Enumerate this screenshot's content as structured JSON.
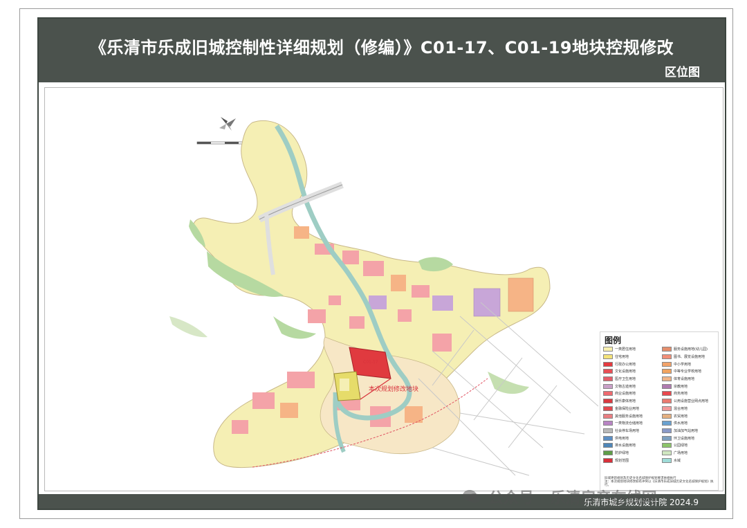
{
  "header": {
    "title": "《乐清市乐成旧城控制性详细规划（修编）》C01-17、C01-19地块控规修改",
    "subtitle": "区位图"
  },
  "map": {
    "site_label": "本次规划修改地块",
    "site_parcel_code": "C01-17",
    "north_arrow": "north-arrow",
    "scale_bar": "scale-bar",
    "colors": {
      "residential": "#f5efb4",
      "commercial": "#f4a3a8",
      "site": "#e03a3f",
      "river": "#9ecdc4",
      "greenland": "#b6d9a1",
      "admin": "#c8a6d8",
      "orange": "#f6b486",
      "road": "#ffffff"
    }
  },
  "legend": {
    "title": "图例",
    "items": [
      {
        "label": "一类居住用地",
        "color": "#f8f0b0"
      },
      {
        "label": "服务设施用地(幼儿园)",
        "color": "#e58e6c"
      },
      {
        "label": "住宅用地",
        "color": "#f4e37a"
      },
      {
        "label": "图书、展览设施用地",
        "color": "#f28f78"
      },
      {
        "label": "行政办公用地",
        "color": "#e53a3f"
      },
      {
        "label": "中小学用地",
        "color": "#f2a36a"
      },
      {
        "label": "文化设施用地",
        "color": "#e84e55"
      },
      {
        "label": "中等专业学校用地",
        "color": "#f1a45f"
      },
      {
        "label": "医疗卫生用地",
        "color": "#e55e6a"
      },
      {
        "label": "体育设施用地",
        "color": "#f0b488"
      },
      {
        "label": "文物古迹用地",
        "color": "#c9a0c8"
      },
      {
        "label": "宗教用地",
        "color": "#b07ab0"
      },
      {
        "label": "商业设施用地",
        "color": "#ee6a6f"
      },
      {
        "label": "商务用地",
        "color": "#e8484e"
      },
      {
        "label": "娱乐康体用地",
        "color": "#d93a40"
      },
      {
        "label": "公用设施营业网点用地",
        "color": "#ea7a70"
      },
      {
        "label": "金融保险业用地",
        "color": "#e2494f"
      },
      {
        "label": "混合用地",
        "color": "#f29a9a"
      },
      {
        "label": "其他服务设施用地",
        "color": "#e97e82"
      },
      {
        "label": "农贸用地",
        "color": "#e5b080"
      },
      {
        "label": "一类物流仓储用地",
        "color": "#b884c4"
      },
      {
        "label": "供水用地",
        "color": "#6aa2d0"
      },
      {
        "label": "社会停车场用地",
        "color": "#b9b9b9"
      },
      {
        "label": "加油加气站用地",
        "color": "#8a9ac8"
      },
      {
        "label": "供电用地",
        "color": "#5c8ec4"
      },
      {
        "label": "环卫设施用地",
        "color": "#7da0c0"
      },
      {
        "label": "排水设施用地",
        "color": "#4f86b8"
      },
      {
        "label": "公园绿地",
        "color": "#8cc46a"
      },
      {
        "label": "防护绿地",
        "color": "#5e9c48"
      },
      {
        "label": "广场用地",
        "color": "#cfe6c0"
      },
      {
        "label": "规划范围",
        "color": "#d8303a"
      },
      {
        "label": "水域",
        "color": "#9edcd8"
      }
    ],
    "notes": [
      "旧城更新规划及历史文化名城保护规划要求依规执行",
      "注：本次规划地块修改如有冲突以《乐清市乐成旧城历史文化名城保护规划》执行。"
    ]
  },
  "footer": {
    "text": "乐清市城乡规划设计院  2024.9"
  },
  "watermark": {
    "text": "公众号 · 乐清房产在线网",
    "icon": "wechat-icon"
  }
}
